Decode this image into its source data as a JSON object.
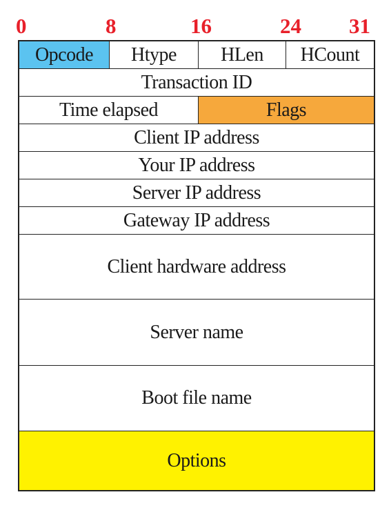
{
  "bit_labels": [
    "0",
    "8",
    "16",
    "24",
    "31"
  ],
  "fields": {
    "opcode": "Opcode",
    "htype": "Htype",
    "hlen": "HLen",
    "hcount": "HCount",
    "transaction_id": "Transaction ID",
    "time_elapsed": "Time elapsed",
    "flags": "Flags",
    "client_ip": "Client IP address",
    "your_ip": "Your IP address",
    "server_ip": "Server IP address",
    "gateway_ip": "Gateway IP address",
    "client_hw": "Client hardware address",
    "server_name": "Server name",
    "boot_file": "Boot file name",
    "options": "Options"
  },
  "colors": {
    "bit_label": "#e8202a",
    "opcode_fill": "#5bc3f0",
    "flags_fill": "#f6a83c",
    "options_fill": "#fff200",
    "border": "#222222"
  }
}
